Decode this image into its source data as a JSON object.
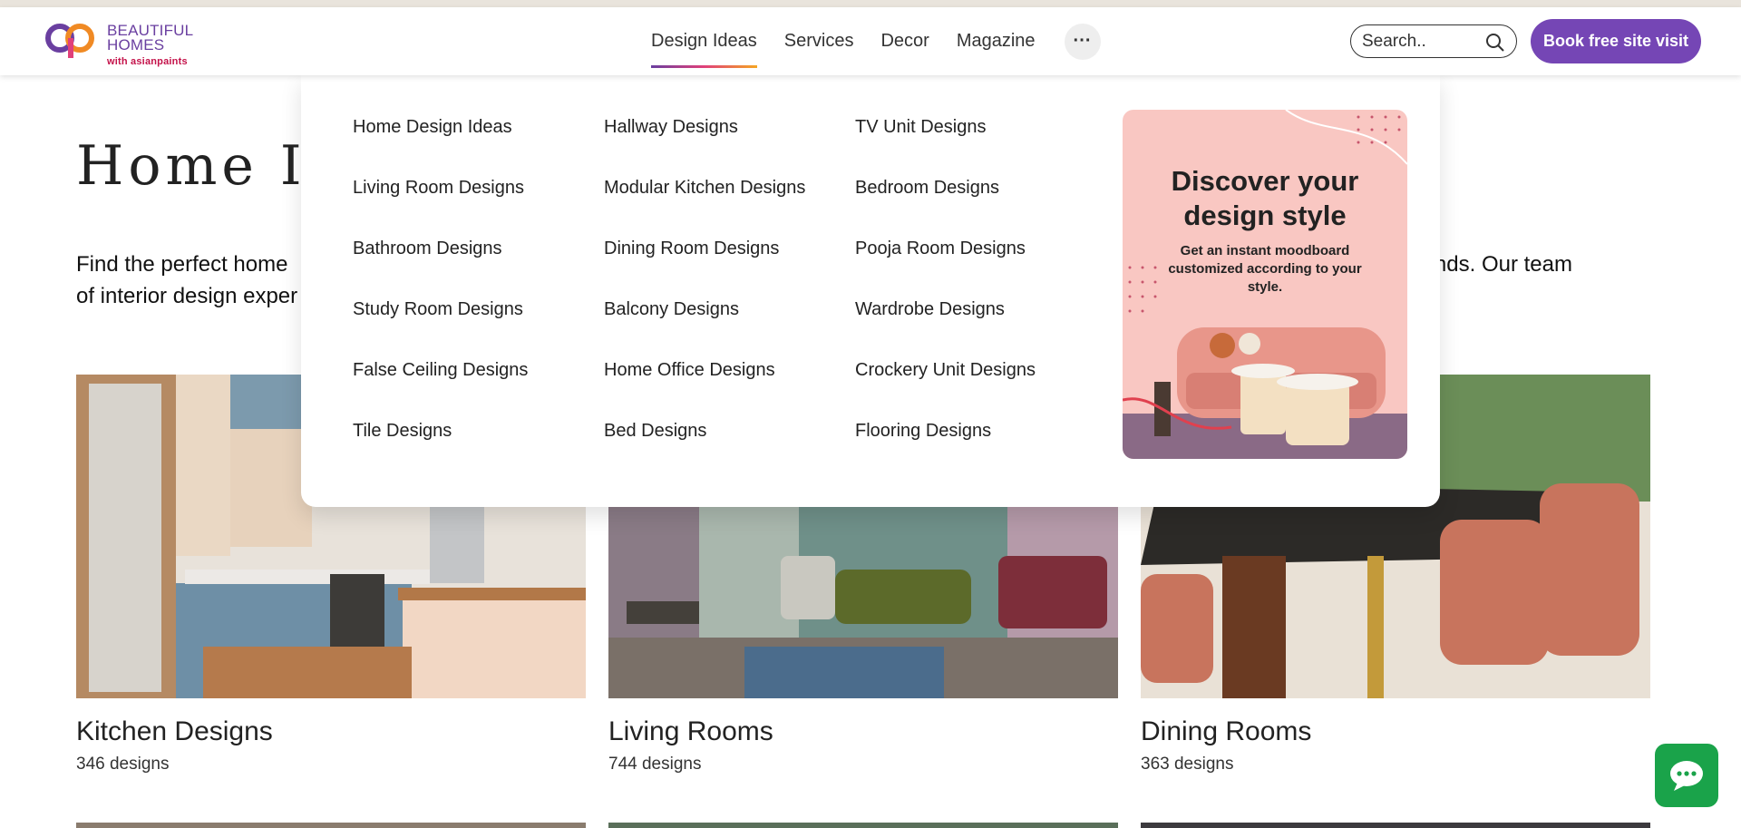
{
  "brand": {
    "line1": "BEAUTIFUL",
    "line2": "HOMES",
    "sub": "with asianpaints"
  },
  "nav": {
    "items": [
      "Design Ideas",
      "Services",
      "Decor",
      "Magazine"
    ],
    "more_label": "···"
  },
  "search": {
    "placeholder": "Search.."
  },
  "cta_label": "Book free site visit",
  "page": {
    "title": "Home I",
    "intro_line1_left": "Find the perfect home",
    "intro_line1_right": "nd trends. Our team",
    "intro_line2": "of interior design exper"
  },
  "mega_menu": {
    "col1": [
      "Home Design Ideas",
      "Living Room Designs",
      "Bathroom Designs",
      "Study Room Designs",
      "False Ceiling Designs",
      "Tile Designs"
    ],
    "col2": [
      "Hallway Designs",
      "Modular Kitchen Designs",
      "Dining Room Designs",
      "Balcony Designs",
      "Home Office Designs",
      "Bed Designs"
    ],
    "col3": [
      "TV Unit Designs",
      "Bedroom Designs",
      "Pooja Room Designs",
      "Wardrobe Designs",
      "Crockery Unit Designs",
      "Flooring Designs"
    ],
    "promo": {
      "title": "Discover your design style",
      "text": "Get an instant moodboard customized according to your style."
    }
  },
  "cards": [
    {
      "title": "Kitchen Designs",
      "count": "346 designs"
    },
    {
      "title": "Living Rooms",
      "count": "744 designs"
    },
    {
      "title": "Dining Rooms",
      "count": "363 designs"
    }
  ],
  "colors": {
    "accent": "#7546b5",
    "chat": "#1aa34a",
    "promo_bg": "#f9c7c2"
  },
  "icons": {
    "search": "search-icon",
    "chat": "chat-icon",
    "more": "more-icon"
  }
}
